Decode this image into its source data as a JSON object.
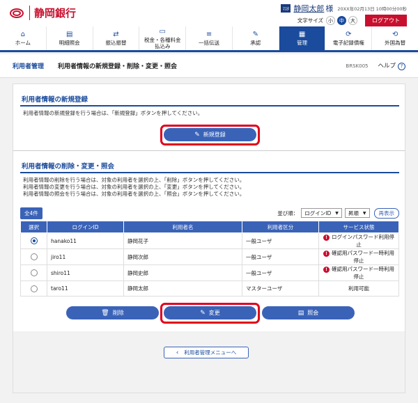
{
  "header": {
    "bank_name": "静岡銀行",
    "user_name": "静岡太郎",
    "user_suffix": "様",
    "login_time": "20XX年02月13日 10時00分00秒",
    "font_size_label": "文字サイズ",
    "font_sizes": [
      "小",
      "中",
      "大"
    ],
    "logout": "ログアウト"
  },
  "nav": [
    {
      "icon": "home-icon",
      "label": "ホーム"
    },
    {
      "icon": "document-icon",
      "label": "明細照会"
    },
    {
      "icon": "transfer-icon",
      "label": "振込振替"
    },
    {
      "icon": "payment-icon",
      "label": "税金・各種料金\n払込み"
    },
    {
      "icon": "batch-icon",
      "label": "一括伝送"
    },
    {
      "icon": "approve-icon",
      "label": "承認"
    },
    {
      "icon": "manage-icon",
      "label": "管理"
    },
    {
      "icon": "e-record-icon",
      "label": "電子記録債権"
    },
    {
      "icon": "forex-icon",
      "label": "外国為替"
    }
  ],
  "breadcrumb": {
    "section": "利用者管理",
    "title": "利用者情報の新規登録・削除・変更・照会",
    "code": "BRSK005",
    "help": "ヘルプ"
  },
  "register": {
    "title": "利用者情報の新規登録",
    "desc": "利用者情報の新規登録を行う場合は、「新規登録」ボタンを押してください。",
    "button": "新規登録"
  },
  "edit": {
    "title": "利用者情報の削除・変更・照会",
    "desc": [
      "利用者情報の削除を行う場合は、対象の利用者を選択の上、「削除」ボタンを押してください。",
      "利用者情報の変更を行う場合は、対象の利用者を選択の上、「変更」ボタンを押してください。",
      "利用者情報の照会を行う場合は、対象の利用者を選択の上、「照会」ボタンを押してください。"
    ],
    "count": "全4件",
    "sort_label": "並び順：",
    "sort_key": "ログインID",
    "sort_order": "昇順",
    "redisplay": "再表示",
    "columns": [
      "選択",
      "ログインID",
      "利用者名",
      "利用者区分",
      "サービス状態"
    ],
    "rows": [
      {
        "selected": true,
        "login_id": "hanako11",
        "name": "静岡花子",
        "type": "一般ユーザ",
        "status": "ログインパスワード利用停止",
        "warn": true
      },
      {
        "selected": false,
        "login_id": "jiro11",
        "name": "静岡次郎",
        "type": "一般ユーザ",
        "status": "確認用パスワード一時利用停止",
        "warn": true
      },
      {
        "selected": false,
        "login_id": "shiro11",
        "name": "静岡史郎",
        "type": "一般ユーザ",
        "status": "確認用パスワード一時利用停止",
        "warn": true
      },
      {
        "selected": false,
        "login_id": "taro11",
        "name": "静岡太郎",
        "type": "マスターユーザ",
        "status": "利用可能",
        "warn": false
      }
    ],
    "delete": "削除",
    "change": "変更",
    "inquiry": "照会"
  },
  "back": "利用者管理メニューへ"
}
